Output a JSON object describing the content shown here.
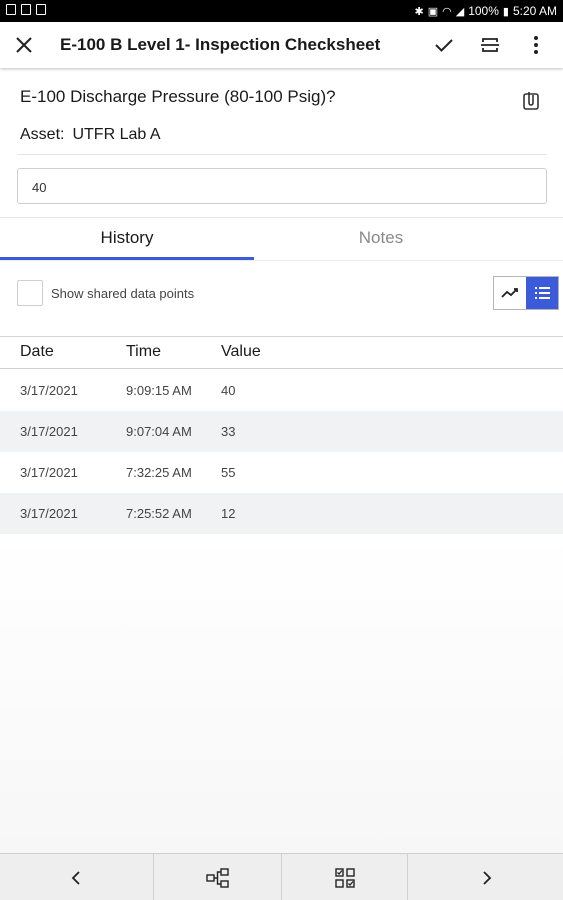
{
  "status_bar": {
    "battery": "100%",
    "time": "5:20 AM"
  },
  "app_bar": {
    "title": "E-100 B Level 1- Inspection Checksheet"
  },
  "question": {
    "text": "E-100 Discharge Pressure (80-100 Psig)?",
    "asset_label": "Asset:",
    "asset_value": "UTFR Lab A",
    "input_value": "40"
  },
  "tabs": [
    {
      "label": "History",
      "active": true
    },
    {
      "label": "Notes",
      "active": false
    }
  ],
  "history": {
    "show_shared_label": "Show shared data points",
    "show_shared_checked": false,
    "view_mode": "list",
    "columns": [
      "Date",
      "Time",
      "Value"
    ],
    "rows": [
      {
        "date": "3/17/2021",
        "time": "9:09:15 AM",
        "value": "40"
      },
      {
        "date": "3/17/2021",
        "time": "9:07:04 AM",
        "value": "33"
      },
      {
        "date": "3/17/2021",
        "time": "7:32:25 AM",
        "value": "55"
      },
      {
        "date": "3/17/2021",
        "time": "7:25:52 AM",
        "value": "12"
      }
    ]
  },
  "colors": {
    "accent": "#3b5bdb",
    "row_alt": "#f1f2f4"
  },
  "icons": {
    "close": "close-icon",
    "check": "check-icon",
    "scan": "scan-icon",
    "more": "more-vert-icon",
    "attach": "attachment-icon",
    "chart_view": "trend-chart-icon",
    "list_view": "list-icon",
    "prev": "chevron-left-icon",
    "hierarchy": "hierarchy-icon",
    "checklist": "checklist-icon",
    "next": "chevron-right-icon"
  }
}
